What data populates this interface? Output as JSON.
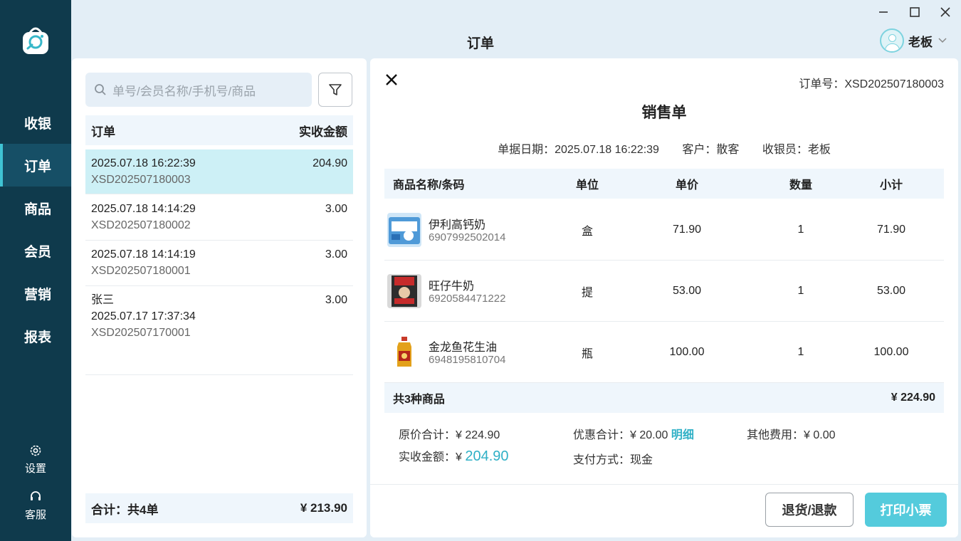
{
  "app": {
    "page_title": "订单",
    "user_name": "老板"
  },
  "sidebar": {
    "items": [
      {
        "label": "收银",
        "icon": "cash-register"
      },
      {
        "label": "订单",
        "icon": "orders",
        "active": true
      },
      {
        "label": "商品",
        "icon": "goods"
      },
      {
        "label": "会员",
        "icon": "members"
      },
      {
        "label": "营销",
        "icon": "marketing"
      },
      {
        "label": "报表",
        "icon": "reports"
      }
    ],
    "settings_label": "设置",
    "service_label": "客服"
  },
  "order_list": {
    "search_placeholder": "单号/会员名称/手机号/商品",
    "header_left": "订单",
    "header_right": "实收金额",
    "orders": [
      {
        "customer": "",
        "datetime": "2025.07.18 16:22:39",
        "amount": "204.90",
        "order_no": "XSD202507180003",
        "selected": true
      },
      {
        "customer": "",
        "datetime": "2025.07.18 14:14:29",
        "amount": "3.00",
        "order_no": "XSD202507180002"
      },
      {
        "customer": "",
        "datetime": "2025.07.18 14:14:19",
        "amount": "3.00",
        "order_no": "XSD202507180001"
      },
      {
        "customer": "张三",
        "datetime": "2025.07.17 17:37:34",
        "amount": "3.00",
        "order_no": "XSD202507170001"
      }
    ],
    "footer_left": "合计：共4单",
    "footer_right": "¥  213.90"
  },
  "detail": {
    "order_no_label": "订单号：XSD202507180003",
    "title": "销售单",
    "date_label": "单据日期：2025.07.18 16:22:39",
    "customer_label": "客户：散客",
    "cashier_label": "收银员：老板",
    "columns": {
      "name": "商品名称/条码",
      "unit": "单位",
      "price": "单价",
      "qty": "数量",
      "subtotal": "小计"
    },
    "items": [
      {
        "name": "伊利高钙奶",
        "barcode": "6907992502014",
        "unit": "盒",
        "price": "71.90",
        "qty": "1",
        "subtotal": "71.90",
        "thumb_color": "#4f9ad8"
      },
      {
        "name": "旺仔牛奶",
        "barcode": "6920584471222",
        "unit": "提",
        "price": "53.00",
        "qty": "1",
        "subtotal": "53.00",
        "thumb_color": "#c62b2b"
      },
      {
        "name": "金龙鱼花生油",
        "barcode": "6948195810704",
        "unit": "瓶",
        "price": "100.00",
        "qty": "1",
        "subtotal": "100.00",
        "thumb_color": "#e3a11b"
      }
    ],
    "summary_left": "共3种商品",
    "summary_right": "¥  224.90",
    "original_total_label": "原价合计：",
    "original_total_value": "¥  224.90",
    "discount_label": "优惠合计：",
    "discount_value": "¥  20.00",
    "discount_detail_link": "明细",
    "other_fees_label": "其他费用：",
    "other_fees_value": "¥  0.00",
    "received_label": "实收金额：",
    "received_currency": "¥",
    "received_value": "204.90",
    "payment_label": "支付方式：",
    "payment_value": "现金",
    "refund_button": "退货/退款",
    "print_button": "打印小票"
  }
}
